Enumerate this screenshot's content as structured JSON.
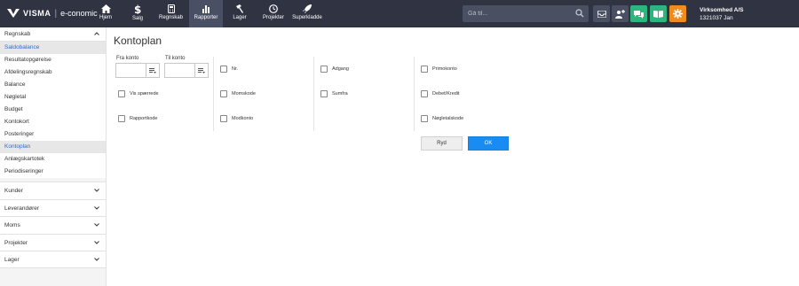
{
  "brand": {
    "logo": "VISMA",
    "product": "e-conomic"
  },
  "nav": [
    {
      "label": "Hjem",
      "icon": "home-icon"
    },
    {
      "label": "Salg",
      "icon": "dollar-icon"
    },
    {
      "label": "Regnskab",
      "icon": "calculator-icon"
    },
    {
      "label": "Rapporter",
      "icon": "bar-chart-icon"
    },
    {
      "label": "Lager",
      "icon": "hammer-icon"
    },
    {
      "label": "Projekter",
      "icon": "clock-icon"
    },
    {
      "label": "Superkladde",
      "icon": "rocket-icon"
    }
  ],
  "search": {
    "placeholder": "Gå til..."
  },
  "company": {
    "name": "Virksomhed A/S",
    "id_user": "1321037 Jan"
  },
  "colors": {
    "topbar": "#2f3342",
    "active_nav": "#4a5064",
    "accent_green": "#2cb67d",
    "accent_orange": "#f08c1c",
    "link_blue": "#2a6bd1",
    "ok_blue": "#1a8bf0"
  },
  "sidebar": {
    "section": "Regnskab",
    "items": [
      "Saldobalance",
      "Resultatopgørelse",
      "Afdelingsregnskab",
      "Balance",
      "Nøgletal",
      "Budget",
      "Kontokort",
      "Posteringer",
      "Kontoplan",
      "Anlægskartotek",
      "Periodiseringer"
    ],
    "groups": [
      "Kunder",
      "Leverandører",
      "Moms",
      "Projekter",
      "Lager"
    ]
  },
  "page": {
    "title": "Kontoplan",
    "fra_label": "Fra konto",
    "til_label": "Til konto",
    "checkboxes": [
      "Vis spærrede",
      "Rapportkode",
      "Nr.",
      "Momskode",
      "Modkonto",
      "Adgang",
      "Sumfra",
      "Primokonto",
      "Debet/Kredit",
      "Nøgletalskode"
    ],
    "ryd_label": "Ryd",
    "ok_label": "OK"
  }
}
